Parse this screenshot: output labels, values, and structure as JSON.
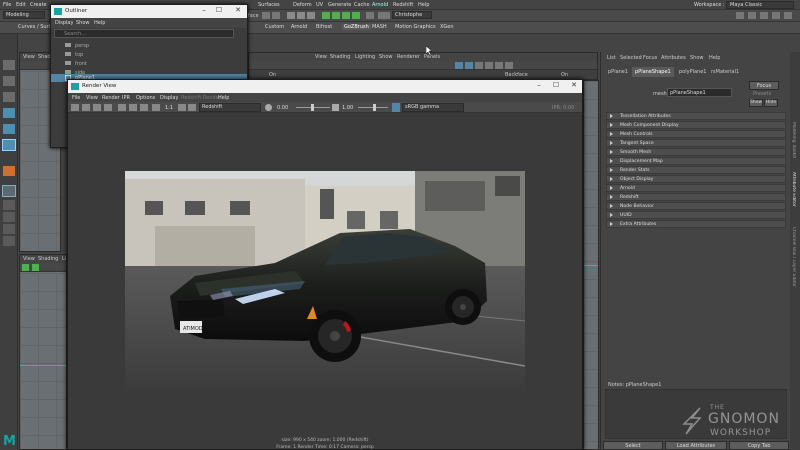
{
  "menubar": {
    "items": [
      "File",
      "Edit",
      "Create"
    ],
    "right_items": [
      "Surfaces",
      "Deform",
      "UV",
      "Generate",
      "Cache",
      "Arnold",
      "Redshift",
      "Help"
    ],
    "workspace_label": "Workspace :",
    "workspace_value": "Maya Classic",
    "mode": "Modeling",
    "user": "Christophe"
  },
  "shelf": {
    "tabs_left": [
      "Curves / Surfa..."
    ],
    "tabs": [
      "Custom",
      "Arnold",
      "Bifrost",
      "GoZBrush",
      "MASH",
      "Motion Graphics",
      "XGen"
    ],
    "fx_label": "face"
  },
  "viewport_top": {
    "menu": [
      "View",
      "Shading",
      "Lighting",
      "Show",
      "Renderer",
      "Panels"
    ],
    "menu_left": [
      "View",
      "Shad"
    ],
    "label_on": "On",
    "label_backface": "Backface",
    "label_on2": "On"
  },
  "viewport_bottom": {
    "menu": [
      "View",
      "Shading",
      "Li"
    ]
  },
  "outliner": {
    "title": "Outliner",
    "menu": [
      "Display",
      "Show",
      "Help"
    ],
    "search_placeholder": "Search...",
    "items": [
      "persp",
      "top",
      "front",
      "side"
    ],
    "selected_item": "pPlane1"
  },
  "render_view": {
    "title": "Render View",
    "menu": [
      "File",
      "View",
      "Render",
      "IPR",
      "Options",
      "Display",
      "Redshift Render",
      "Help"
    ],
    "renderer": "Redshift",
    "exposure": "0.00",
    "gamma": "1.00",
    "color_space": "sRGB gamma",
    "ratio": "1:1",
    "ipr_label": "IPR: 0:00",
    "info_line1": "size: 990 x 540 zoom: 1.000       (Redshift)",
    "info_line2": "Frame: 1       Render Time: 0:17       Camera: persp",
    "plate_text": "ATIMOD"
  },
  "attribute_editor": {
    "menu": [
      "List",
      "Selected",
      "Focus",
      "Attributes",
      "Show",
      "Help"
    ],
    "tabs": [
      "pPlane1",
      "pPlaneShape1",
      "polyPlane1",
      "rsMaterial1"
    ],
    "mesh_label": "mesh:",
    "mesh_value": "pPlaneShape1",
    "focus_button": "Focus",
    "presets_button": "Presets",
    "show_button": "Show",
    "hide_button": "Hide",
    "sections": [
      "Tessellation Attributes",
      "Mesh Component Display",
      "Mesh Controls",
      "Tangent Space",
      "Smooth Mesh",
      "Displacement Map",
      "Render Stats",
      "Object Display",
      "Arnold",
      "Redshift",
      "Node Behavior",
      "UUID",
      "Extra Attributes"
    ],
    "notes_label": "Notes:  pPlaneShape1",
    "select_button": "Select",
    "load_button": "Load Attributes",
    "copy_button": "Copy Tab"
  },
  "side_tabs": [
    "Modeling Toolkit",
    "Attribute Editor",
    "Channel Box / Layer Editor"
  ],
  "watermark": {
    "line1": "THE",
    "line2": "GNOMON",
    "line3": "WORKSHOP"
  },
  "colors": {
    "maya_teal": "#18a3a0",
    "selection_blue": "#5285a6",
    "accent_green": "#4fb04f"
  }
}
